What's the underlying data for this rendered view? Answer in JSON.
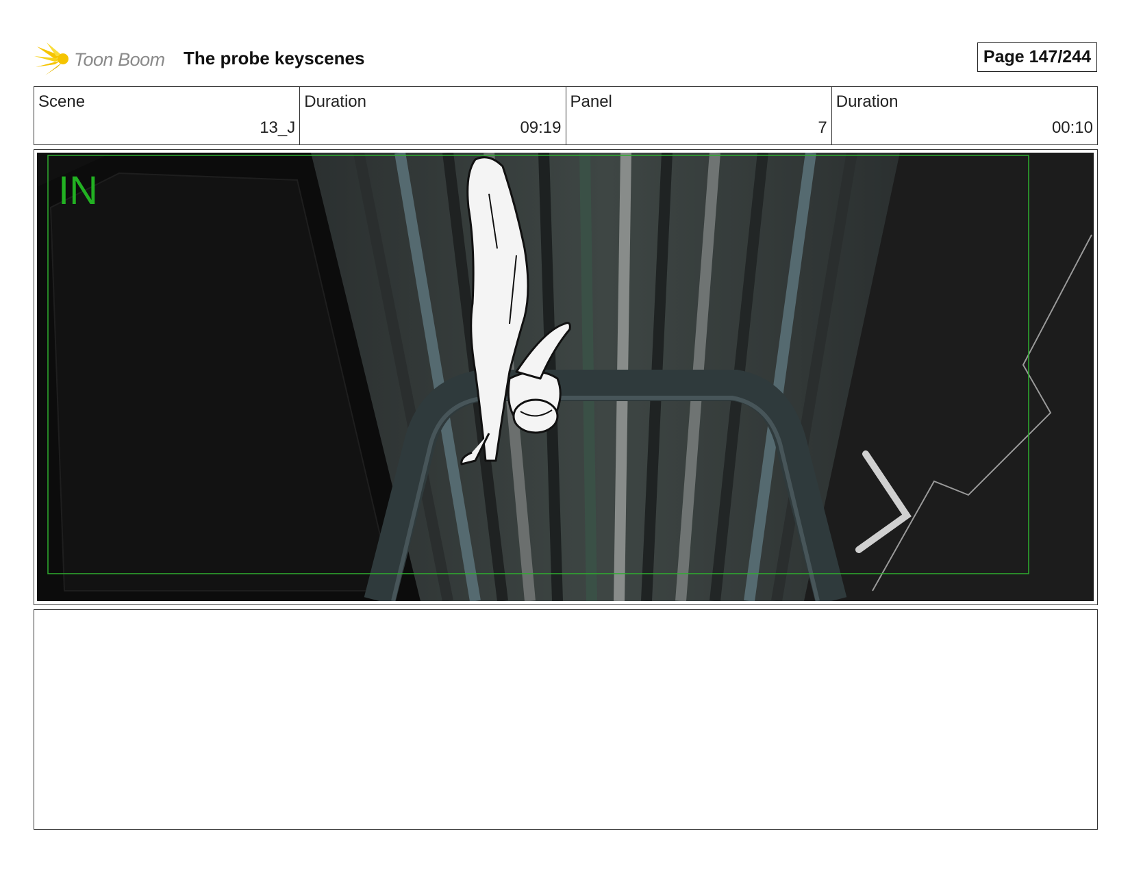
{
  "header": {
    "logo_text": "Toon Boom",
    "title": "The probe keyscenes",
    "page_label": "Page 147/244"
  },
  "info": [
    {
      "label": "Scene",
      "value": "13_J"
    },
    {
      "label": "Duration",
      "value": "09:19"
    },
    {
      "label": "Panel",
      "value": "7"
    },
    {
      "label": "Duration",
      "value": "00:10"
    }
  ],
  "panel": {
    "overlay_label": "IN",
    "overlay_color": "#22b122"
  },
  "colors": {
    "logo_accent": "#f5c400",
    "frame_border": "#333333"
  }
}
